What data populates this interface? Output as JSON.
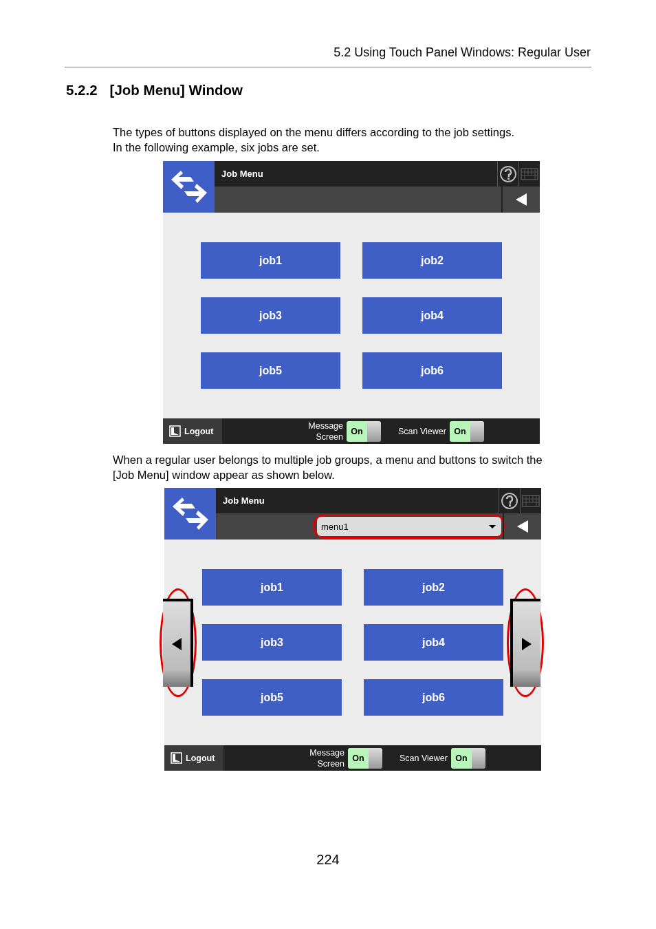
{
  "running_header": "5.2 Using Touch Panel Windows: Regular User",
  "heading": {
    "number": "5.2.2",
    "title": "[Job Menu] Window"
  },
  "sections": [
    {
      "paragraph": [
        "The types of buttons displayed on the menu differs according to the job settings.",
        "In the following example, six jobs are set."
      ],
      "screen": {
        "title": "Job Menu",
        "jobs": [
          "job1",
          "job2",
          "job3",
          "job4",
          "job5",
          "job6"
        ],
        "footer": {
          "logout": "Logout",
          "toggles": [
            {
              "label": "Message Screen",
              "state": "On",
              "on": true
            },
            {
              "label": "Scan Viewer",
              "state": "On",
              "on": true
            }
          ]
        }
      }
    },
    {
      "paragraph": [
        "When a regular user belongs to multiple job groups, a menu and buttons to switch the",
        "[Job Menu] window appear as shown below."
      ],
      "screen": {
        "title": "Job Menu",
        "menu": {
          "value": "menu1",
          "highlighted": true
        },
        "page_buttons": [
          {
            "kind": "previous",
            "highlighted": true
          },
          {
            "kind": "next",
            "highlighted": true
          }
        ],
        "jobs": [
          "job1",
          "job2",
          "job3",
          "job4",
          "job5",
          "job6"
        ],
        "footer": {
          "logout": "Logout",
          "toggles": [
            {
              "label": "Message Screen",
              "state": "On",
              "on": true
            },
            {
              "label": "Scan Viewer",
              "state": "On",
              "on": true
            }
          ]
        }
      }
    }
  ],
  "page_number": "224"
}
